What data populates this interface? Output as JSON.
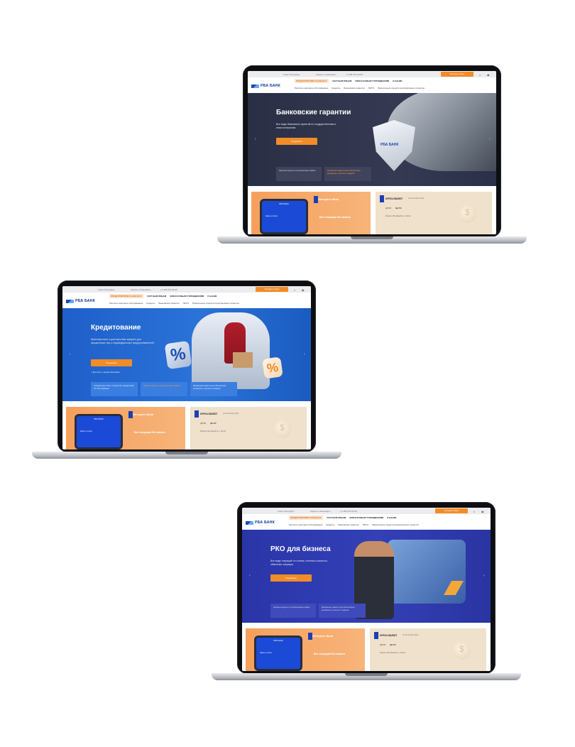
{
  "brand": {
    "logo_text": "РБА БАНК",
    "accent": "#f28c28",
    "primary": "#1e4bb0"
  },
  "topbar": {
    "city": "Санкт-Петербург",
    "offices": "Офисы и банкоматы",
    "phone": "+7 495 270-03-68",
    "internet_bank_label": "Интернет-банк",
    "search_icon": "search-icon",
    "eye_icon": "accessibility-eye-icon"
  },
  "nav": {
    "menu": [
      "ПРЕДПРИЯТИЯМ И БИЗНЕСУ",
      "ЧАСТНЫМ ЛИЦАМ",
      "ФИНАНСОВЫМ УЧРЕЖДЕНИЯМ",
      "О БАНКЕ"
    ],
    "submenu": [
      "Расчетно-кассовое обслуживание",
      "Кредиты",
      "Банковские гарантии",
      "ПЕТЭ",
      "Привлечение средств корпоративных клиентов"
    ]
  },
  "slides": [
    {
      "title": "Банковские гарантии",
      "subtitle": "Все виды банковских гарантий по государственным и иным контрактам",
      "button": "Подробнее",
      "cards": [
        "Целевые кредиты и корпоративные займы",
        "Банковские гарантии для обеспечения договоров и участия в тендерах"
      ]
    },
    {
      "title": "Кредитование",
      "subtitle": "Краткосрочные и долгосрочные кредиты для юридических лиц и индивидуальных предпринимателей",
      "button": "Подробнее",
      "extra": "Доступно с экрана банкомата",
      "cards": [
        "Специальные счета: платежи без ограничений, ИТ-обслуживание",
        "Целевые кредиты и корпоративные займы",
        "Банковские гарантии для обеспечения договоров и участия в тендерах"
      ]
    },
    {
      "title": "РКО для бизнеса",
      "subtitle": "Все виды операций по счетам, платежи и валютно-обменные операции",
      "button": "Подробнее",
      "cards": [
        "Целевые кредиты и корпоративные займы",
        "Банковские гарантии для обеспечения договоров и участия в тендерах"
      ]
    }
  ],
  "promo": {
    "internet_bank_title": "Интернет-банк",
    "internet_bank_tagline": "Все операции без визита",
    "phone_header": "РБА БАНК",
    "phone_text": "Карты и счета",
    "rates_title": "КУРСЫ ВАЛЮТ",
    "rates_date": "на 29 ноября 2021",
    "rates_col1": "ЦБ РФ",
    "rates_col2": "ЦБ РФ",
    "rates_address_label": "Филиал",
    "rates_address": "Литейный пр-т, 11/лит"
  }
}
